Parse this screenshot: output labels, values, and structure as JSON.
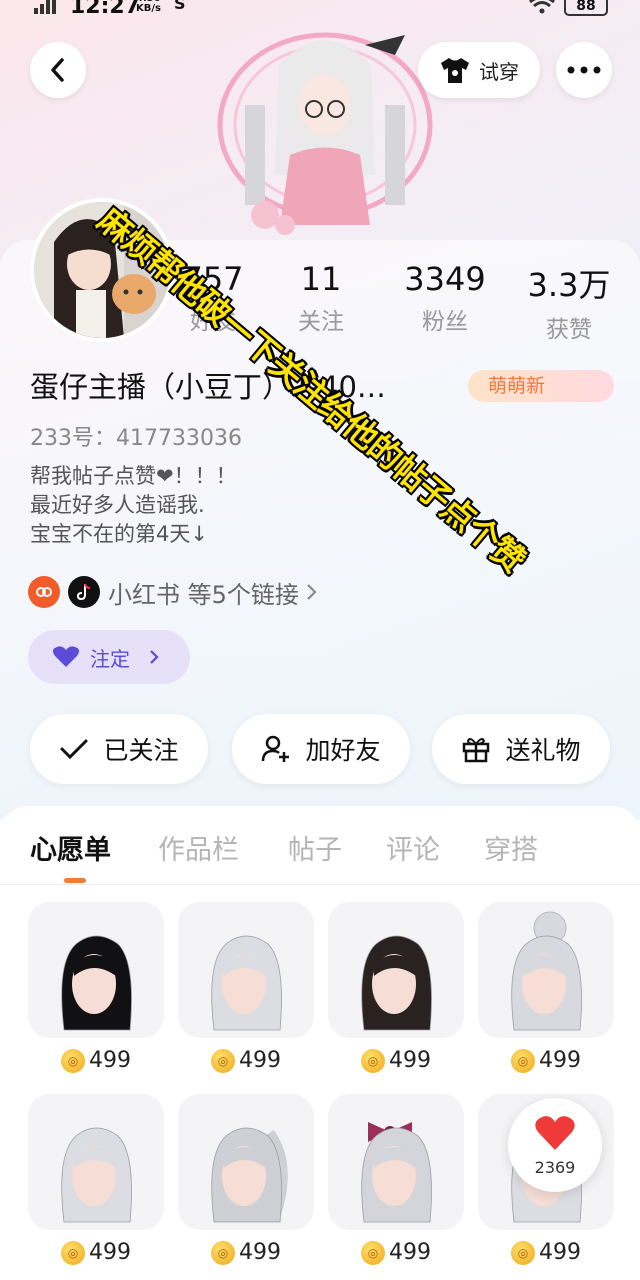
{
  "status_bar": {
    "time": "12:27",
    "net_speed": "4.30\nKB/s",
    "battery": "88"
  },
  "header": {
    "try_on_label": "试穿"
  },
  "overlay_caption": "麻烦帮他破一下关注给他的帖子点个赞",
  "profile": {
    "avatar_caption": "233号 417733036",
    "stats": [
      {
        "value": "757",
        "label": "好友"
      },
      {
        "value": "11",
        "label": "关注"
      },
      {
        "value": "3349",
        "label": "粉丝"
      },
      {
        "value": "3.3万",
        "label": "获赞"
      }
    ],
    "name": "蛋仔主播（小豆丁）冲40…",
    "badge": "萌萌新",
    "uid": "233号：417733036",
    "bio": "帮我帖子点赞❤！！！\n最近好多人造谣我.\n宝宝不在的第4天↓",
    "links_label": "小红书 等5个链接",
    "bond_label": "注定"
  },
  "actions": {
    "follow": "已关注",
    "add_friend": "加好友",
    "gift": "送礼物"
  },
  "tabs": [
    "心愿单",
    "作品栏",
    "帖子",
    "评论",
    "穿搭"
  ],
  "wishlist": [
    {
      "price": "499",
      "hair": "black"
    },
    {
      "price": "499",
      "hair": "silver"
    },
    {
      "price": "499",
      "hair": "dark-brown"
    },
    {
      "price": "499",
      "hair": "silver-bun"
    },
    {
      "price": "499",
      "hair": "silver"
    },
    {
      "price": "499",
      "hair": "silver-ponytail"
    },
    {
      "price": "499",
      "hair": "silver-bow"
    },
    {
      "price": "499",
      "hair": "silver"
    }
  ],
  "like_count": "2369",
  "colors": {
    "accent": "#f47a3a",
    "bond": "#5b4bd6",
    "overlay_text": "#ffe400",
    "like_heart": "#f03a3a"
  }
}
